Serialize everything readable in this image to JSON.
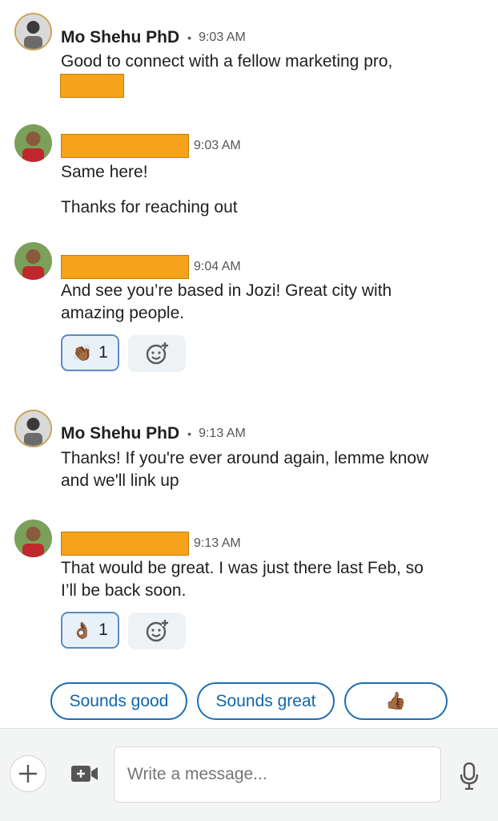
{
  "messages": [
    {
      "sender": "Mo Shehu PhD",
      "time": "9:03 AM",
      "lines": [
        "Good to connect with a fellow marketing pro,"
      ]
    },
    {
      "sender": "",
      "time": "9:03 AM",
      "lines": [
        "Same here!",
        "Thanks for reaching out"
      ]
    },
    {
      "sender": "",
      "time": "9:04 AM",
      "lines": [
        "And see you’re based in Jozi! Great city with",
        "amazing people."
      ],
      "reaction": {
        "emoji": "👏🏾",
        "count": "1"
      }
    },
    {
      "sender": "Mo Shehu PhD",
      "time": "9:13 AM",
      "lines": [
        "Thanks! If you're ever around again, lemme know",
        "and we'll link up"
      ]
    },
    {
      "sender": "",
      "time": "9:13 AM",
      "lines": [
        "That would be great. I was just there last Feb, so",
        "I’ll be back soon."
      ],
      "reaction": {
        "emoji": "👌🏾",
        "count": "1"
      }
    }
  ],
  "quick_replies": [
    "Sounds good",
    "Sounds great",
    "👍🏾"
  ],
  "composer": {
    "placeholder": "Write a message..."
  },
  "icons": {
    "add_reaction": "add-reaction-icon",
    "attach": "plus-icon",
    "video": "video-add-icon",
    "mic": "microphone-icon"
  },
  "colors": {
    "accent": "#1266a8",
    "redaction": "#f7a21b",
    "reaction_bg": "#e8f0f8"
  }
}
